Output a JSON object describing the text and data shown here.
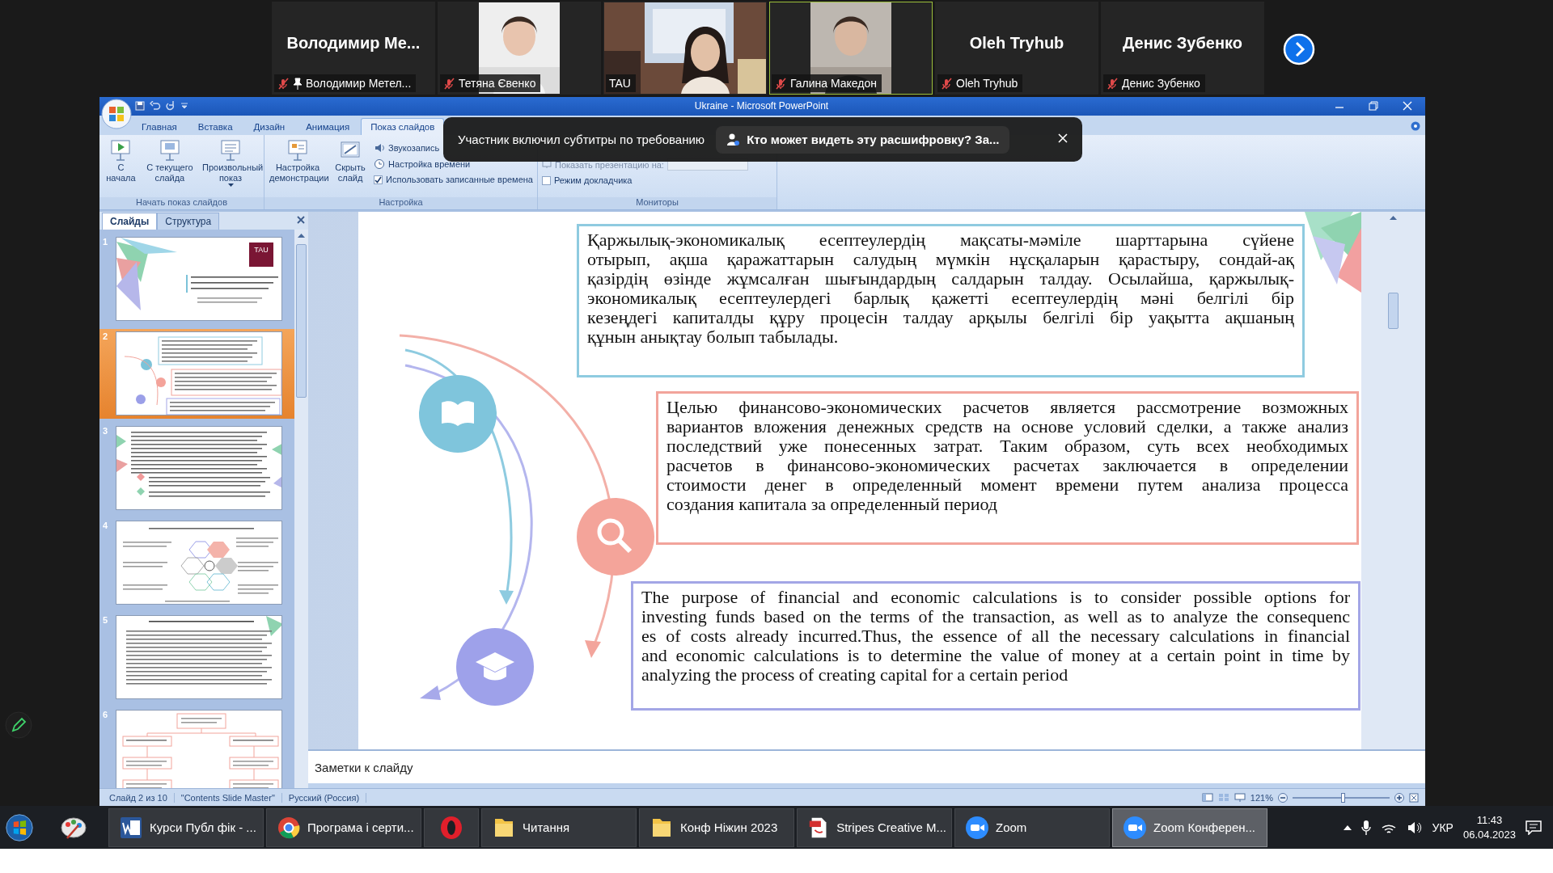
{
  "meeting_strip": {
    "participants": [
      {
        "kind": "name",
        "display_name": "Володимир Ме...",
        "label": "Володимир Метел...",
        "muted": true,
        "pinned": true,
        "selected": false
      },
      {
        "label": "Тетяна Євенко",
        "muted": true,
        "pinned": false,
        "selected": false
      },
      {
        "kind": "video",
        "label": "TAU",
        "muted": false,
        "pinned": false,
        "selected": false
      },
      {
        "label": "Галина Македон",
        "muted": true,
        "pinned": false,
        "selected": true
      },
      {
        "kind": "name",
        "display_name": "Oleh Tryhub",
        "label": "Oleh Tryhub",
        "muted": true,
        "pinned": false,
        "selected": false
      },
      {
        "kind": "name",
        "display_name": "Денис Зубенко",
        "label": "Денис Зубенко",
        "muted": true,
        "pinned": false,
        "selected": false
      }
    ]
  },
  "window": {
    "title": "Ukraine - Microsoft PowerPoint"
  },
  "ribbon": {
    "tabs": [
      {
        "label": "Главная",
        "selected": false
      },
      {
        "label": "Вставка",
        "selected": false
      },
      {
        "label": "Дизайн",
        "selected": false
      },
      {
        "label": "Анимация",
        "selected": false
      },
      {
        "label": "Показ слайдов",
        "selected": true
      }
    ],
    "groups": [
      {
        "label": "Начать показ слайдов",
        "items": [
          {
            "kind": "big",
            "label": "С начала",
            "dropdown": false
          },
          {
            "kind": "big",
            "label": "С текущего слайда",
            "dropdown": false
          },
          {
            "kind": "big",
            "label": "Произвольный показ",
            "dropdown": true
          }
        ]
      },
      {
        "label": "Настройка",
        "items": [
          {
            "kind": "big",
            "label": "Настройка демонстрации",
            "dropdown": false
          },
          {
            "kind": "big",
            "label": "Скрыть слайд",
            "dropdown": false
          },
          {
            "kind": "small",
            "label": "Звукозапись"
          },
          {
            "kind": "small",
            "label": "Настройка времени"
          },
          {
            "kind": "check",
            "label": "Использовать записанные времена",
            "checked": true
          }
        ]
      },
      {
        "label": "Мониторы",
        "items": [
          {
            "kind": "combo",
            "label": "Показать презентацию на:",
            "disabled": true
          },
          {
            "kind": "check",
            "label": "Режим докладчика",
            "checked": false
          }
        ]
      }
    ]
  },
  "caption_banner": {
    "message": "Участник включил субтитры по требованию",
    "link": "Кто может видеть эту расшифровку? За..."
  },
  "slides_panel": {
    "tabs": [
      {
        "label": "Слайды",
        "selected": true
      },
      {
        "label": "Структура",
        "selected": false
      }
    ],
    "thumbnails": [
      {
        "number": "1",
        "kind": "title",
        "logo": "TAU",
        "selected": false
      },
      {
        "number": "2",
        "kind": "boxes",
        "selected": true
      },
      {
        "number": "3",
        "kind": "bullets",
        "selected": false
      },
      {
        "number": "4",
        "kind": "hexagons",
        "selected": false
      },
      {
        "number": "5",
        "kind": "text",
        "selected": false
      },
      {
        "number": "6",
        "kind": "diagram",
        "selected": false
      }
    ]
  },
  "slide": {
    "paragraphs": [
      {
        "color": "#8fcbe0",
        "lines": [
          "Қаржылық-экономикалық есептеулердің мақсаты-мәміле шарттарына сүйене",
          "отырып, ақша қаражаттарын салудың мүмкін нұсқаларын қарастыру, сондай-ақ",
          "қазірдің өзінде жұмсалған шығындардың салдарын талдау. Осылайша, қаржылық-",
          "экономикалық есептеулердегі барлық қажетті есептеулердің мәні белгілі бір",
          "кезеңдегі капиталды құру процесін талдау арқылы белгілі бір уақытта ақшаның",
          "құнын анықтау болып табылады."
        ]
      },
      {
        "color": "#f2a49b",
        "lines": [
          "Целью финансово-экономических расчетов является рассмотрение возможных",
          "вариантов вложения денежных средств на основе условий сделки, а также анализ",
          "последствий уже понесенных затрат. Таким образом, суть всех необходимых",
          "расчетов в финансово-экономических расчетах заключается в определении",
          "стоимости денег в определенный момент времени путем анализа процесса",
          "создания капитала за определенный период"
        ]
      },
      {
        "color": "#a3a6e6",
        "lines": [
          "The purpose of financial and economic calculations is to consider possible options for",
          "investing funds based on the terms of the transaction, as well as to analyze the consequenc",
          "es of costs already incurred.Thus, the essence of all the necessary calculations in financial",
          "and economic calculations is to determine the value of money at a certain point in time by",
          "analyzing the process of creating capital for a certain period"
        ]
      }
    ]
  },
  "notes": {
    "placeholder": "Заметки к слайду"
  },
  "status_bar": {
    "items": [
      "Слайд 2 из 10",
      "\"Contents Slide Master\"",
      "Русский (Россия)"
    ],
    "zoom": "121%",
    "level": 0.52
  },
  "taskbar": {
    "items": [
      {
        "kind": "word",
        "label": "Курси Публ фік - ...",
        "active": false
      },
      {
        "kind": "chrome",
        "label": "Програма і серти...",
        "active": false
      },
      {
        "kind": "opera",
        "active": false
      },
      {
        "kind": "folder",
        "label": "Читання",
        "active": false
      },
      {
        "kind": "folder",
        "label": "Конф Ніжин 2023",
        "active": false
      },
      {
        "kind": "pdf",
        "label": "Stripes Creative M...",
        "active": false
      },
      {
        "kind": "zoom",
        "label": "Zoom",
        "active": false
      },
      {
        "kind": "zoom",
        "label": "Zoom Конферен...",
        "active": true
      }
    ],
    "language": "УКР",
    "time": "11:43",
    "date": "06.04.2023"
  }
}
